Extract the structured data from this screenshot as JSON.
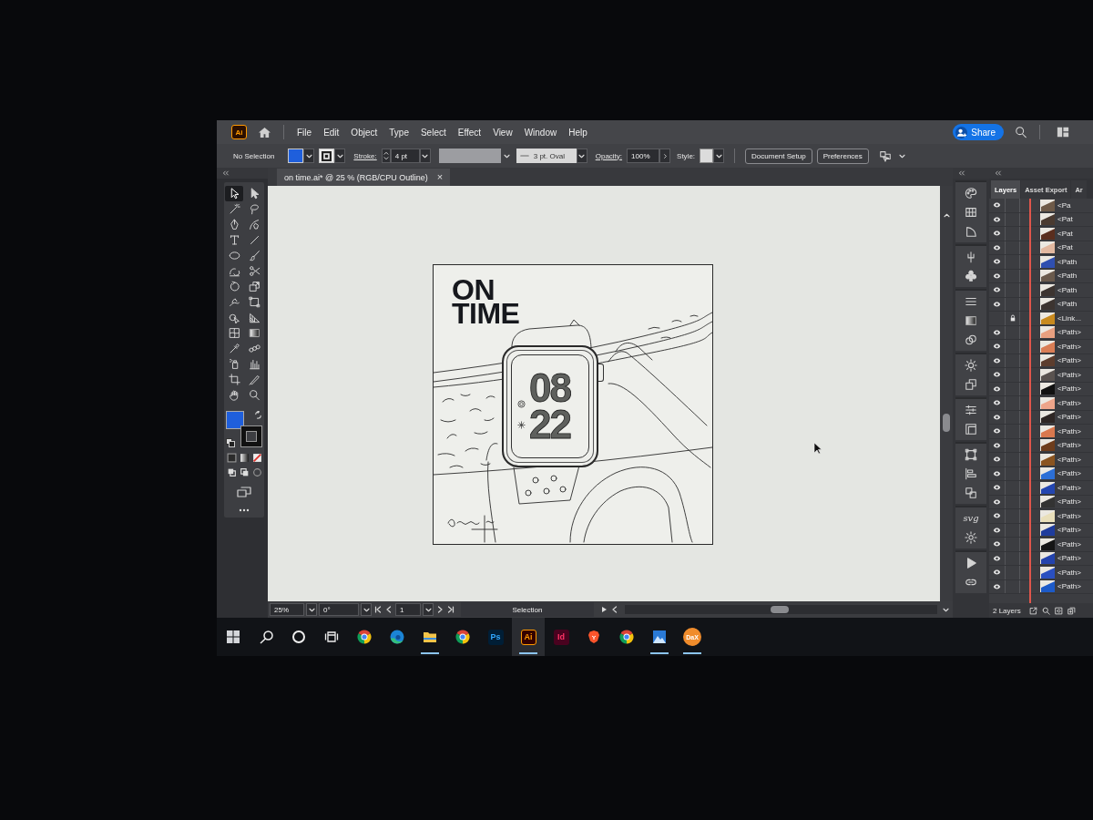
{
  "app": {
    "logo": "Ai"
  },
  "menu": [
    "File",
    "Edit",
    "Object",
    "Type",
    "Select",
    "Effect",
    "View",
    "Window",
    "Help"
  ],
  "header": {
    "share": "Share"
  },
  "control_bar": {
    "selection": "No Selection",
    "fill": {
      "color": "#1f5fdc"
    },
    "stroke_label": "Stroke:",
    "stroke_weight": "4 pt",
    "brush": "3 pt. Oval",
    "opacity_label": "Opacity:",
    "opacity": "100%",
    "style_label": "Style:",
    "buttons": [
      "Document Setup",
      "Preferences"
    ]
  },
  "document_tab": {
    "title": "on time.ai* @ 25 % (RGB/CPU Outline)",
    "close": "×"
  },
  "toolbar": {
    "tools": [
      {
        "kind": "selection",
        "selected": true
      },
      {
        "kind": "direct-selection",
        "selected": false
      },
      {
        "kind": "magic-wand",
        "selected": false
      },
      {
        "kind": "lasso",
        "selected": false
      },
      {
        "kind": "pen",
        "selected": false
      },
      {
        "kind": "curvature",
        "selected": false
      },
      {
        "kind": "type",
        "selected": false
      },
      {
        "kind": "line",
        "selected": false
      },
      {
        "kind": "ellipse",
        "selected": false
      },
      {
        "kind": "paintbrush",
        "selected": false
      },
      {
        "kind": "shaper",
        "selected": false
      },
      {
        "kind": "scissors",
        "selected": false
      },
      {
        "kind": "rotate",
        "selected": false
      },
      {
        "kind": "scale",
        "selected": false
      },
      {
        "kind": "puppet-warp",
        "selected": false
      },
      {
        "kind": "free-transform",
        "selected": false
      },
      {
        "kind": "shape-builder",
        "selected": false
      },
      {
        "kind": "perspective-grid",
        "selected": false
      },
      {
        "kind": "mesh",
        "selected": false
      },
      {
        "kind": "gradient",
        "selected": false
      },
      {
        "kind": "eyedropper",
        "selected": false
      },
      {
        "kind": "blend",
        "selected": false
      },
      {
        "kind": "symbol-sprayer",
        "selected": false
      },
      {
        "kind": "column-graph",
        "selected": false
      },
      {
        "kind": "artboard",
        "selected": false
      },
      {
        "kind": "slice",
        "selected": false
      },
      {
        "kind": "hand",
        "selected": false
      },
      {
        "kind": "zoom",
        "selected": false
      }
    ],
    "fill": {
      "color": "#1f5fdc"
    }
  },
  "artboard": {
    "title": [
      "ON",
      "TIME"
    ],
    "watch_time": [
      "08",
      "22"
    ]
  },
  "status_bar": {
    "zoom": "25%",
    "rotation": "0°",
    "artboard": "1",
    "tool": "Selection"
  },
  "dock": [
    [
      {
        "kind": "color"
      },
      {
        "kind": "swatches"
      },
      {
        "kind": "color-guide"
      }
    ],
    [
      {
        "kind": "brushes"
      },
      {
        "kind": "symbols"
      }
    ],
    [
      {
        "kind": "stroke"
      },
      {
        "kind": "gradient"
      },
      {
        "kind": "transparency"
      }
    ],
    [
      {
        "kind": "appearance"
      },
      {
        "kind": "graphic-styles"
      }
    ],
    [
      {
        "kind": "properties"
      },
      {
        "kind": "libraries"
      }
    ],
    [
      {
        "kind": "transform"
      },
      {
        "kind": "align"
      },
      {
        "kind": "pathfinder"
      }
    ],
    [
      {
        "kind": "svg-interactivity",
        "label": "svg"
      },
      {
        "kind": "asset-export"
      }
    ],
    [
      {
        "kind": "actions"
      },
      {
        "kind": "links"
      }
    ]
  ],
  "layers_panel": {
    "tabs": [
      {
        "label": "Layers",
        "selected": true
      },
      {
        "label": "Asset Export",
        "selected": false
      },
      {
        "label": "Ar",
        "selected": false
      }
    ],
    "rows": [
      {
        "name": "<Pa",
        "visible": true,
        "locked": false,
        "color": "#6e5a48"
      },
      {
        "name": "<Pat",
        "visible": true,
        "locked": false,
        "color": "#4a3a30"
      },
      {
        "name": "<Pat",
        "visible": true,
        "locked": false,
        "color": "#5a2e1e"
      },
      {
        "name": "<Pat",
        "visible": true,
        "locked": false,
        "color": "#e2b8a0"
      },
      {
        "name": "<Path",
        "visible": true,
        "locked": false,
        "color": "#2f4fb0"
      },
      {
        "name": "<Path",
        "visible": true,
        "locked": false,
        "color": "#6a5a4c"
      },
      {
        "name": "<Path",
        "visible": true,
        "locked": false,
        "color": "#3c3430"
      },
      {
        "name": "<Path",
        "visible": true,
        "locked": false,
        "color": "#3c3430"
      },
      {
        "name": "<Link...",
        "visible": false,
        "locked": true,
        "color": "#c88a1e"
      },
      {
        "name": "<Path>",
        "visible": true,
        "locked": false,
        "color": "#e8a080"
      },
      {
        "name": "<Path>",
        "visible": true,
        "locked": false,
        "color": "#d97d55"
      },
      {
        "name": "<Path>",
        "visible": true,
        "locked": false,
        "color": "#5c3d2e"
      },
      {
        "name": "<Path>",
        "visible": true,
        "locked": false,
        "color": "#5a5350"
      },
      {
        "name": "<Path>",
        "visible": true,
        "locked": false,
        "color": "#111111"
      },
      {
        "name": "<Path>",
        "visible": true,
        "locked": false,
        "color": "#eea58a"
      },
      {
        "name": "<Path>",
        "visible": true,
        "locked": false,
        "color": "#2e2624"
      },
      {
        "name": "<Path>",
        "visible": true,
        "locked": false,
        "color": "#d9784e"
      },
      {
        "name": "<Path>",
        "visible": true,
        "locked": false,
        "color": "#6e3d1c"
      },
      {
        "name": "<Path>",
        "visible": true,
        "locked": false,
        "color": "#8a5420"
      },
      {
        "name": "<Path>",
        "visible": true,
        "locked": false,
        "color": "#2c6fd6"
      },
      {
        "name": "<Path>",
        "visible": true,
        "locked": false,
        "color": "#2446b0"
      },
      {
        "name": "<Path>",
        "visible": true,
        "locked": false,
        "color": "#333333"
      },
      {
        "name": "<Path>",
        "visible": true,
        "locked": false,
        "color": "#e9dfba"
      },
      {
        "name": "<Path>",
        "visible": true,
        "locked": false,
        "color": "#1f3c9c"
      },
      {
        "name": "<Path>",
        "visible": true,
        "locked": false,
        "color": "#151515"
      },
      {
        "name": "<Path>",
        "visible": true,
        "locked": false,
        "color": "#2443ad"
      },
      {
        "name": "<Path>",
        "visible": true,
        "locked": false,
        "color": "#2a4fbf"
      },
      {
        "name": "<Path>",
        "visible": true,
        "locked": false,
        "color": "#1d5ac8"
      }
    ],
    "footer": "2 Layers"
  },
  "taskbar": [
    {
      "kind": "start",
      "running": false,
      "selected": false
    },
    {
      "kind": "search",
      "running": false,
      "selected": false
    },
    {
      "kind": "cortana",
      "running": false,
      "selected": false
    },
    {
      "kind": "task-view",
      "running": false,
      "selected": false
    },
    {
      "kind": "chrome",
      "running": false,
      "selected": false
    },
    {
      "kind": "edge",
      "running": false,
      "selected": false
    },
    {
      "kind": "explorer",
      "running": true,
      "selected": false
    },
    {
      "kind": "chrome",
      "running": false,
      "selected": false
    },
    {
      "kind": "photoshop",
      "label": "Ps",
      "running": false,
      "selected": false
    },
    {
      "kind": "illustrator",
      "label": "Ai",
      "running": true,
      "selected": true
    },
    {
      "kind": "indesign",
      "label": "Id",
      "running": false,
      "selected": false
    },
    {
      "kind": "brave",
      "running": false,
      "selected": false
    },
    {
      "kind": "chrome",
      "running": false,
      "selected": false
    },
    {
      "kind": "photos",
      "running": true,
      "selected": false
    },
    {
      "kind": "dax",
      "label": "DaX",
      "running": true,
      "selected": false
    }
  ]
}
